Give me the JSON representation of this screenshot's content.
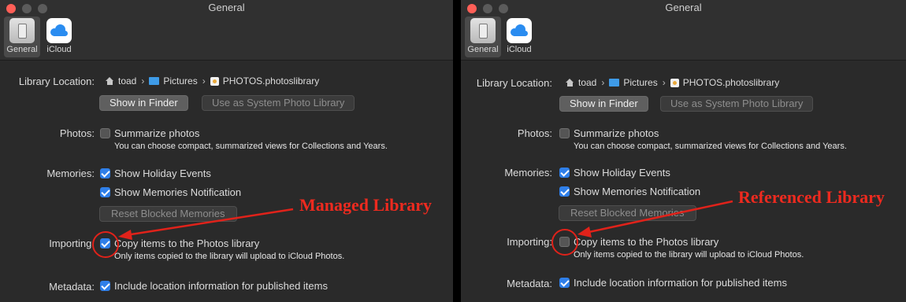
{
  "colors": {
    "accent": "#2f7fe9",
    "annotation": "#ee2a1f",
    "window_bg": "#2a2a2a",
    "close_light": "#ff5f57"
  },
  "panels": [
    {
      "window_title": "General",
      "toolbar": {
        "general_label": "General",
        "icloud_label": "iCloud",
        "selected": "General"
      },
      "library_location": {
        "label": "Library Location:",
        "path": [
          "toad",
          "Pictures",
          "PHOTOS.photoslibrary"
        ],
        "path_icons": [
          "home-icon",
          "folder-icon",
          "photos-library-icon"
        ],
        "show_in_finder": "Show in Finder",
        "use_as_system": "Use as System Photo Library"
      },
      "photos": {
        "label": "Photos:",
        "summarize": "Summarize photos",
        "summarize_checked": false,
        "note": "You can choose compact, summarized views for Collections and Years."
      },
      "memories": {
        "label": "Memories:",
        "holiday": "Show Holiday Events",
        "holiday_checked": true,
        "notification": "Show Memories Notification",
        "notification_checked": true,
        "reset_button": "Reset Blocked Memories"
      },
      "importing": {
        "label": "Importing:",
        "copy": "Copy items to the Photos library",
        "copy_checked": true,
        "note": "Only items copied to the library will upload to iCloud Photos."
      },
      "metadata": {
        "label": "Metadata:",
        "include": "Include location information for published items",
        "include_checked": true
      },
      "annotation": "Managed Library"
    },
    {
      "window_title": "General",
      "toolbar": {
        "general_label": "General",
        "icloud_label": "iCloud",
        "selected": "General"
      },
      "library_location": {
        "label": "Library Location:",
        "path": [
          "toad",
          "Pictures",
          "PHOTOS.photoslibrary"
        ],
        "path_icons": [
          "home-icon",
          "folder-icon",
          "photos-library-icon"
        ],
        "show_in_finder": "Show in Finder",
        "use_as_system": "Use as System Photo Library"
      },
      "photos": {
        "label": "Photos:",
        "summarize": "Summarize photos",
        "summarize_checked": false,
        "note": "You can choose compact, summarized views for Collections and Years."
      },
      "memories": {
        "label": "Memories:",
        "holiday": "Show Holiday Events",
        "holiday_checked": true,
        "notification": "Show Memories Notification",
        "notification_checked": true,
        "reset_button": "Reset Blocked Memories"
      },
      "importing": {
        "label": "Importing:",
        "copy": "Copy items to the Photos library",
        "copy_checked": false,
        "note": "Only items copied to the library will upload to iCloud Photos."
      },
      "metadata": {
        "label": "Metadata:",
        "include": "Include location information for published items",
        "include_checked": true
      },
      "annotation": "Referenced Library"
    }
  ]
}
